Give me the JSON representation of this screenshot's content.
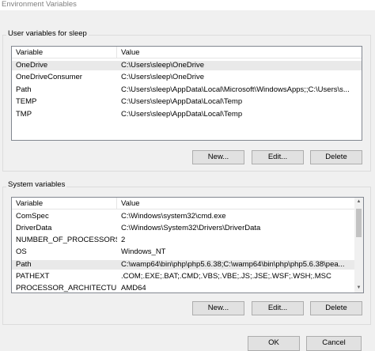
{
  "window": {
    "title": "Environment Variables"
  },
  "user_vars": {
    "label": "User variables for sleep",
    "columns": [
      "Variable",
      "Value"
    ],
    "rows": [
      {
        "variable": "OneDrive",
        "value": "C:\\Users\\sleep\\OneDrive"
      },
      {
        "variable": "OneDriveConsumer",
        "value": "C:\\Users\\sleep\\OneDrive"
      },
      {
        "variable": "Path",
        "value": "C:\\Users\\sleep\\AppData\\Local\\Microsoft\\WindowsApps;;C:\\Users\\s..."
      },
      {
        "variable": "TEMP",
        "value": "C:\\Users\\sleep\\AppData\\Local\\Temp"
      },
      {
        "variable": "TMP",
        "value": "C:\\Users\\sleep\\AppData\\Local\\Temp"
      }
    ],
    "buttons": {
      "new": "New...",
      "edit": "Edit...",
      "delete": "Delete"
    }
  },
  "system_vars": {
    "label": "System variables",
    "columns": [
      "Variable",
      "Value"
    ],
    "rows": [
      {
        "variable": "ComSpec",
        "value": "C:\\Windows\\system32\\cmd.exe"
      },
      {
        "variable": "DriverData",
        "value": "C:\\Windows\\System32\\Drivers\\DriverData"
      },
      {
        "variable": "NUMBER_OF_PROCESSORS",
        "value": "2"
      },
      {
        "variable": "OS",
        "value": "Windows_NT"
      },
      {
        "variable": "Path",
        "value": "C:\\wamp64\\bin\\php\\php5.6.38;C:\\wamp64\\bin\\php\\php5.6.38\\pea..."
      },
      {
        "variable": "PATHEXT",
        "value": ".COM;.EXE;.BAT;.CMD;.VBS;.VBE;.JS;.JSE;.WSF;.WSH;.MSC"
      },
      {
        "variable": "PROCESSOR_ARCHITECTURE",
        "value": "AMD64"
      }
    ],
    "buttons": {
      "new": "New...",
      "edit": "Edit...",
      "delete": "Delete"
    }
  },
  "dialog_buttons": {
    "ok": "OK",
    "cancel": "Cancel"
  }
}
